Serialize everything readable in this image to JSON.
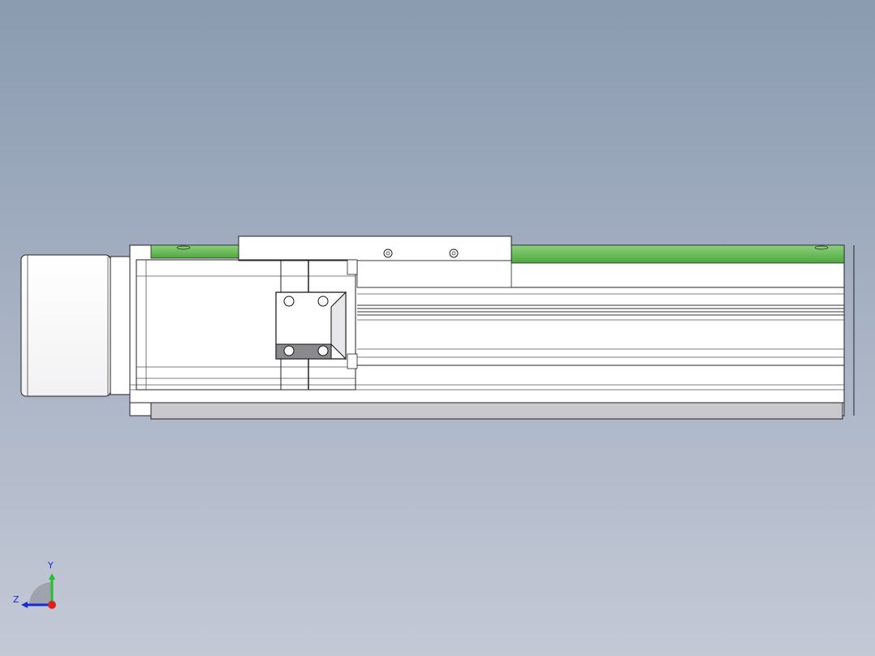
{
  "viewport": {
    "background_top": "#8a9bb0",
    "background_bottom": "#c4c9d6"
  },
  "model": {
    "name": "linear-actuator-module",
    "guide_rail_color": "#6abf5a",
    "body_color": "#ffffff",
    "edge_color": "#1a1a1a",
    "shadow_color": "#c8c8cc"
  },
  "triad": {
    "x_label": "",
    "y_label": "Y",
    "z_label": "Z",
    "y_color": "#22c02a",
    "z_color": "#1a2bd6",
    "origin_color": "#e02020"
  }
}
